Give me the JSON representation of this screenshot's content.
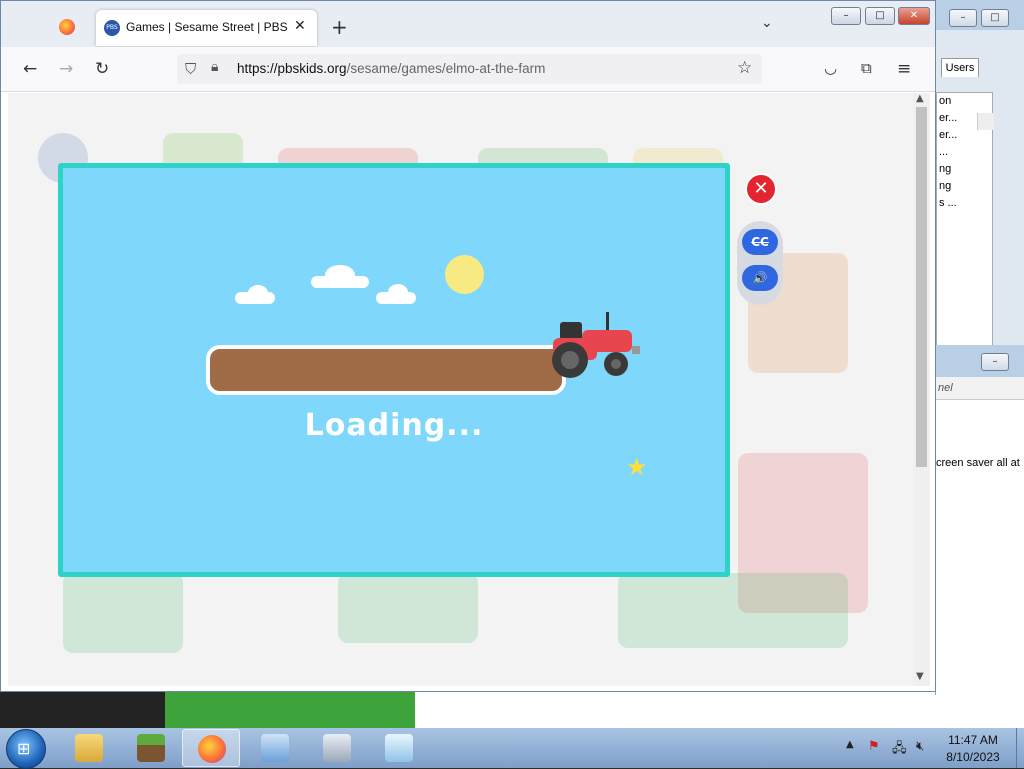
{
  "browser": {
    "tab_title": "Games | Sesame Street | PBS KIDS",
    "favicon_text": "PBS KIDS",
    "url_host": "https://pbskids.org",
    "url_path": "/sesame/games/elmo-at-the-farm",
    "new_tab": "+",
    "tab_close": "✕",
    "tab_list": "⌄"
  },
  "game": {
    "loading_text": "Loading...",
    "progress": 0,
    "cc_label": "CC",
    "sound_label": "🔊",
    "close_label": "✕"
  },
  "background_window": {
    "tab_label": "Users",
    "list_items": [
      "on",
      "er...",
      "er...",
      "...",
      "ng",
      "ng",
      "s ..."
    ],
    "address_text": "nel",
    "body_text": "creen saver all at "
  },
  "taskbar": {
    "time": "11:47 AM",
    "date": "8/10/2023"
  },
  "colors": {
    "modal_bg": "#7fd8fb",
    "modal_border": "#2ed3c8",
    "progress_track": "#a06b47",
    "close_red": "#e32530",
    "control_blue": "#2f67e1"
  }
}
